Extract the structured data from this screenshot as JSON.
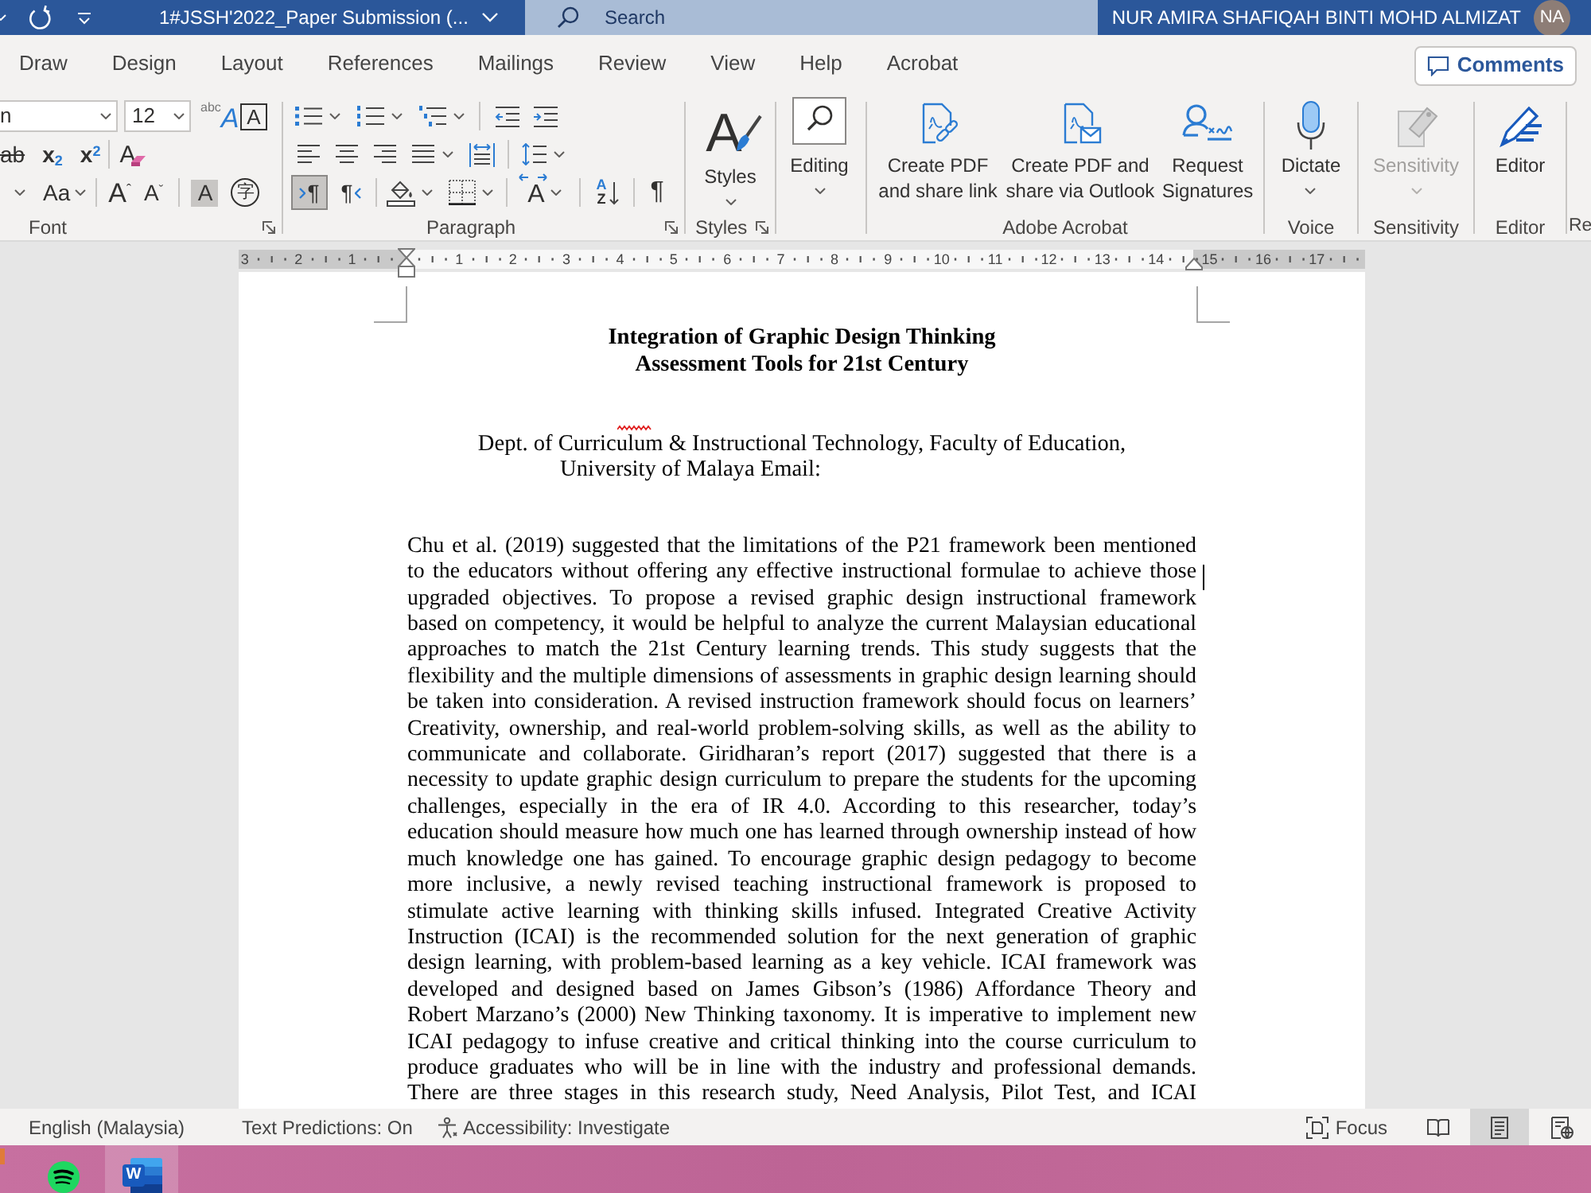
{
  "title_bar": {
    "title": "1#JSSH'2022_Paper Submission (...",
    "search": {
      "placeholder": "Search"
    },
    "user_name": "NUR AMIRA SHAFIQAH BINTI MOHD ALMIZAT",
    "avatar": "NA"
  },
  "ribbon_tabs": [
    {
      "label": "Draw",
      "selected": false
    },
    {
      "label": "Design",
      "selected": false
    },
    {
      "label": "Layout",
      "selected": false
    },
    {
      "label": "References",
      "selected": false
    },
    {
      "label": "Mailings",
      "selected": false
    },
    {
      "label": "Review",
      "selected": false
    },
    {
      "label": "View",
      "selected": false
    },
    {
      "label": "Help",
      "selected": false
    },
    {
      "label": "Acrobat",
      "selected": false
    }
  ],
  "comments_button": "Comments",
  "ribbon": {
    "font": {
      "label": "Font",
      "font_name": "n",
      "font_size": "12",
      "buttons": [
        {
          "kind": "text-effects",
          "glyphs": [
            "abc",
            "A"
          ]
        },
        {
          "kind": "boxed",
          "glyph": "A"
        },
        {
          "kind": "strikethrough",
          "glyph": "ab"
        },
        {
          "kind": "script",
          "glyph": "x$_{2}$"
        },
        {
          "kind": "script",
          "glyph": "x$^{2}$"
        },
        {
          "kind": "clear-formatting",
          "glyph": "A"
        },
        {
          "kind": "font-color"
        },
        {
          "kind": "change-case",
          "glyph": "Aa"
        },
        {
          "kind": "grow",
          "glyph": "A$^{ˆ}$"
        },
        {
          "kind": "shrink",
          "glyph": "A$^{ˇ}$"
        },
        {
          "kind": "shaded",
          "glyph": "A"
        },
        {
          "kind": "enclosed",
          "glyph": "字"
        }
      ]
    },
    "paragraph": {
      "label": "Paragraph",
      "direction_buttons": [
        {
          "kind": "left-to-right",
          "glyph": "¶",
          "selected": true
        },
        {
          "kind": "right-to-left",
          "glyph": "¶",
          "selected": false
        }
      ],
      "spacing_glyph": "A",
      "sort_glyphs": [
        "A",
        "Z"
      ],
      "marks_glyph": "¶"
    },
    "styles": {
      "label": "Styles",
      "button": "Styles",
      "icon_glyph": "A"
    },
    "editing": {
      "button": "Editing"
    },
    "adobe_acrobat": {
      "label": "Adobe Acrobat",
      "buttons": [
        {
          "kind": "share-link",
          "label_lines": [
            "Create PDF",
            "and share link"
          ]
        },
        {
          "kind": "share-outlook",
          "label_lines": [
            "Create PDF and",
            "share via Outlook"
          ]
        },
        {
          "kind": "signatures",
          "label_lines": [
            "Request",
            "Signatures"
          ]
        }
      ]
    },
    "voice": {
      "label": "Voice",
      "button": "Dictate"
    },
    "sensitivity": {
      "label": "Sensitivity",
      "button": "Sensitivity",
      "disabled": true
    },
    "editor": {
      "label": "Editor",
      "button": "Editor"
    },
    "cut_group": {
      "label": "Re"
    }
  },
  "ruler": {
    "left_labels": [
      "3",
      "2",
      "1"
    ],
    "right_labels": [
      "1",
      "2",
      "3",
      "4",
      "5",
      "6",
      "7",
      "8",
      "9",
      "10",
      "11",
      "12",
      "13",
      "14",
      "15",
      "16",
      "17"
    ]
  },
  "document": {
    "title_lines": [
      "Integration of Graphic Design Thinking",
      "Assessment Tools for 21st Century"
    ],
    "affiliation_lines": [
      "Dept. of Curriculum & Instructional Technology, Faculty of Education,",
      "University of Malaya Email:"
    ],
    "body_lines": [
      "Chu et al. (2019) suggested that the limitations of the P21 framework been mentioned",
      "to the educators without offering any effective instructional formulae to achieve those",
      "upgraded objectives. To propose a revised graphic design instructional framework",
      "based on competency, it would be helpful to analyze the current Malaysian educational",
      "approaches to match the 21st Century learning trends. This study suggests that the",
      "flexibility and the multiple dimensions of assessments in graphic design learning should",
      "be taken into consideration. A revised instruction framework should focus on learners’",
      "Creativity, ownership, and real-world problem-solving skills, as well as the ability to",
      "communicate and collaborate. Giridharan’s report (2017) suggested that there is a",
      "necessity to update graphic design curriculum to prepare the students for the upcoming",
      "challenges, especially in the era of IR 4.0. According to this researcher, today’s",
      "education should measure how much one has learned through ownership instead of how",
      "much knowledge one has gained. To encourage graphic design pedagogy to become",
      "more inclusive, a newly revised teaching instructional framework is proposed to",
      "stimulate active learning with thinking skills infused. Integrated Creative Activity",
      "Instruction (ICAI) is the recommended solution for the next generation of graphic",
      "design learning, with problem-based learning as a key vehicle. ICAI framework was",
      "developed and designed based on James Gibson’s (1986) Affordance Theory and",
      "Robert Marzano’s (2000) New Thinking taxonomy. It is imperative to implement new",
      "ICAI pedagogy to infuse creative and critical thinking into the course curriculum to",
      "produce graduates who will be in line with the industry and professional demands.",
      "There are three stages in this research study, Need Analysis, Pilot Test, and ICAI"
    ]
  },
  "status_bar": {
    "language": "English (Malaysia)",
    "text_predictions": "Text Predictions: On",
    "accessibility": "Accessibility: Investigate",
    "focus": "Focus",
    "views": [
      {
        "kind": "read",
        "selected": false
      },
      {
        "kind": "print",
        "selected": true
      },
      {
        "kind": "web",
        "selected": false
      }
    ]
  },
  "taskbar": {
    "apps": [
      {
        "kind": "cut-off",
        "selected": false
      },
      {
        "kind": "music",
        "selected": false
      },
      {
        "kind": "word",
        "glyph": "W",
        "selected": true
      }
    ]
  }
}
